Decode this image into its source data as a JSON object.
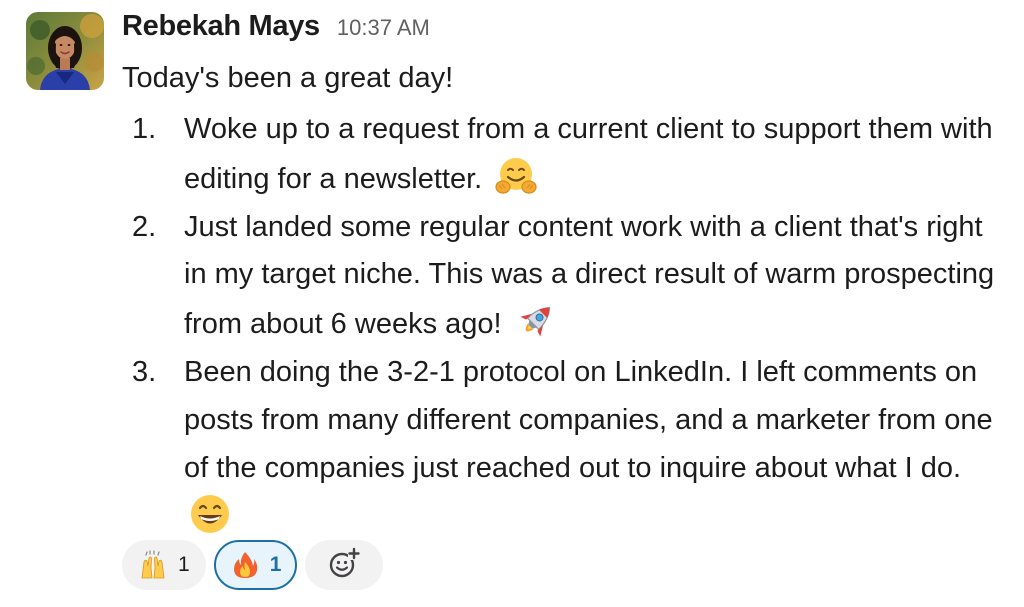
{
  "message": {
    "sender": "Rebekah Mays",
    "timestamp": "10:37 AM",
    "avatar": "user-avatar-photo",
    "intro": "Today's been a great day!",
    "items": [
      {
        "number": "1.",
        "text": "Woke up to a request from a current client to support them with editing for a newsletter.",
        "emoji": "hugging-face-emoji"
      },
      {
        "number": "2.",
        "text": "Just landed some regular content work with a client that's right in my target niche. This was a direct result of warm prospecting from about 6 weeks ago!",
        "emoji": "rocket-emoji"
      },
      {
        "number": "3.",
        "text": "Been doing the 3-2-1 protocol on LinkedIn. I left comments on posts from many different companies, and a marketer from one of the companies just reached out to inquire about what I do.",
        "emoji": "grinning-face-emoji"
      }
    ]
  },
  "reactions": [
    {
      "emoji": "raised-hands-emoji",
      "count": "1",
      "active": false
    },
    {
      "emoji": "fire-emoji",
      "count": "1",
      "active": true
    }
  ],
  "add_reaction": {
    "icon": "add-reaction-icon"
  },
  "colors": {
    "text": "#1d1c1d",
    "timestamp": "#616061",
    "reaction_bg": "#f2f2f2",
    "reaction_active_bg": "#e8f4fb",
    "reaction_active_border": "#1d6fa5"
  }
}
